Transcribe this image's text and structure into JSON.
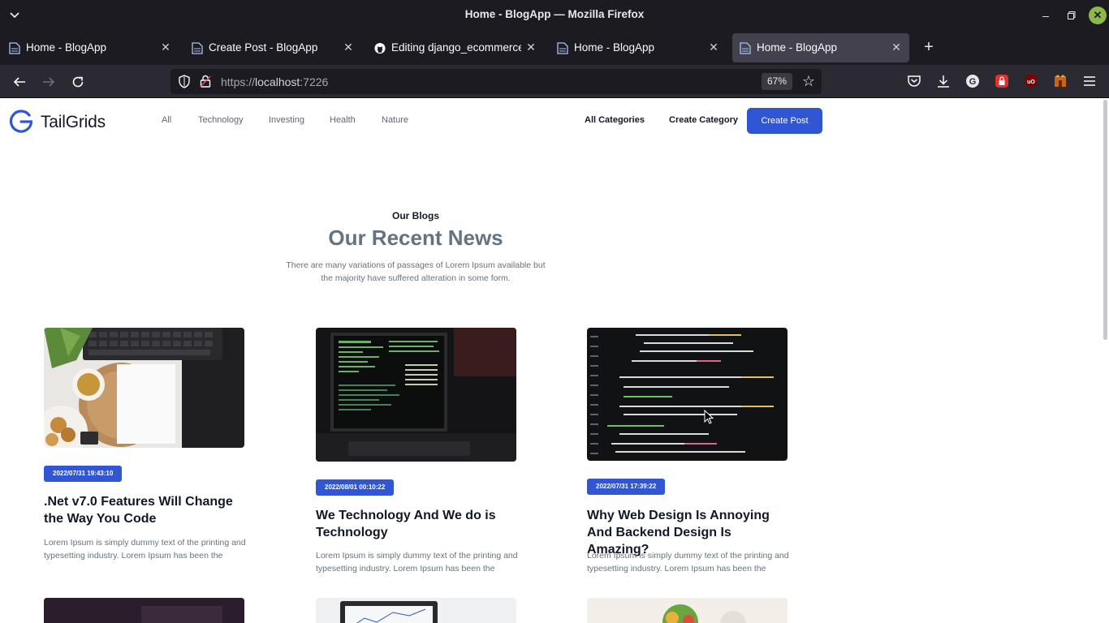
{
  "browser": {
    "window_title": "Home - BlogApp — Mozilla Firefox",
    "tabs": [
      {
        "label": "Home - BlogApp",
        "active": false
      },
      {
        "label": "Create Post - BlogApp",
        "active": false
      },
      {
        "label": "Editing django_ecommerce",
        "active": false
      },
      {
        "label": "Home - BlogApp",
        "active": false
      },
      {
        "label": "Home - BlogApp",
        "active": true
      }
    ],
    "url_scheme": "https://",
    "url_host": "localhost",
    "url_port": ":7226",
    "zoom": "67%"
  },
  "site": {
    "logo_text": "TailGrids",
    "categories": [
      "All",
      "Technology",
      "Investing",
      "Health",
      "Nature"
    ],
    "all_categories_label": "All Categories",
    "create_category_label": "Create Category",
    "create_post_label": "Create Post",
    "brand_color": "#3056d3"
  },
  "blog_section": {
    "eyebrow": "Our Blogs",
    "title": "Our Recent News",
    "description": "There are many variations of passages of Lorem Ipsum available but the majority have suffered alteration in some form."
  },
  "posts": [
    {
      "date": "2022/07/31 19:43:10",
      "title": ".Net v7.0 Features Will Change the Way You Code",
      "excerpt": "Lorem Ipsum is simply dummy text of the printing and typesetting industry. Lorem Ipsum has been the"
    },
    {
      "date": "2022/08/01 00:10:22",
      "title": "We Technology And We do is Technology",
      "excerpt": "Lorem Ipsum is simply dummy text of the printing and typesetting industry. Lorem Ipsum has been the"
    },
    {
      "date": "2022/07/31 17:39:22",
      "title": "Why Web Design Is Annoying And Backend Design Is Amazing?",
      "excerpt": "Lorem Ipsum is simply dummy text of the printing and typesetting industry. Lorem Ipsum has been the"
    }
  ]
}
